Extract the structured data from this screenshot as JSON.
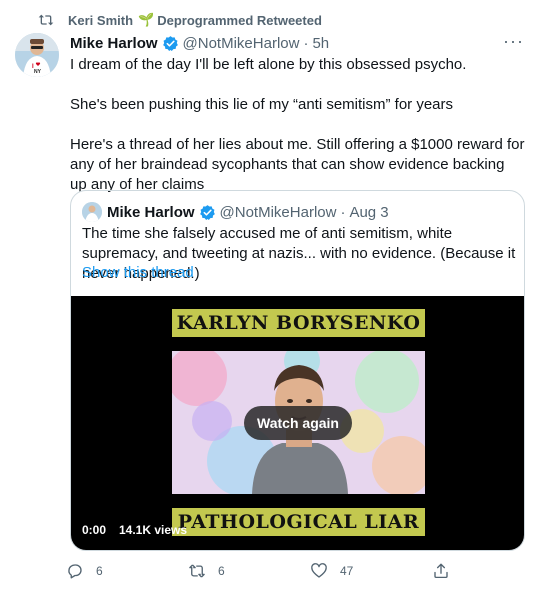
{
  "retweet_context": {
    "user": "Keri Smith",
    "emoji": "🌱",
    "label": "Deprogrammed Retweeted"
  },
  "tweet": {
    "author_name": "Mike Harlow",
    "author_handle": "@NotMikeHarlow",
    "separator": "·",
    "time": "5h",
    "more_label": "···",
    "paragraphs": [
      "I dream of the day I'll be left alone by this obsessed psycho.",
      "She's been pushing this lie of my “anti semitism” for years",
      "Here's a thread of her lies about me. Still offering a $1000 reward for any of her braindead sycophants that can show evidence backing up any of her claims"
    ]
  },
  "quoted_tweet": {
    "author_name": "Mike Harlow",
    "author_handle": "@NotMikeHarlow",
    "separator": "·",
    "time": "Aug 3",
    "text": "The time she falsely accused me of anti semitism, white supremacy, and tweeting at nazis... with no evidence. (Because it never happened.)",
    "show_thread_label": "Show this thread",
    "video": {
      "top_banner": "KARLYN BORYSENKO",
      "bottom_banner": "PATHOLOGICAL LIAR",
      "watch_again_label": "Watch again",
      "timestamp": "0:00",
      "views": "14.1K views"
    }
  },
  "actions": {
    "reply_count": "6",
    "retweet_count": "6",
    "like_count": "47"
  },
  "colors": {
    "accent": "#1d9bf0",
    "muted": "#536471",
    "banner_yellow": "#c3c84f"
  }
}
